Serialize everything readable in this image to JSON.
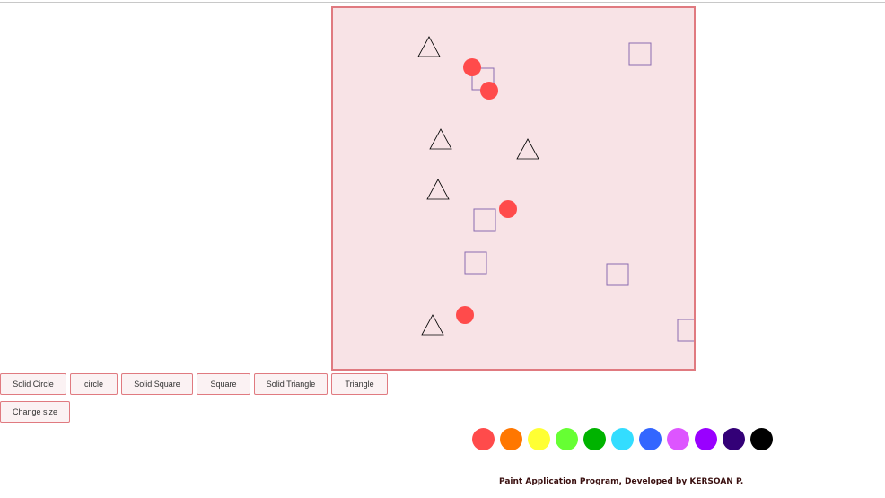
{
  "toolbar": {
    "solid_circle": "Solid Circle",
    "circle": "circle",
    "solid_square": "Solid Square",
    "square": "Square",
    "solid_triangle": "Solid Triangle",
    "triangle": "Triangle",
    "change_size": "Change size"
  },
  "canvas": {
    "background": "#f8e3e6",
    "border": "#e07a80",
    "shape_colors": {
      "solid_circle": "#ff4b4b",
      "square_stroke": "#8a6bb0",
      "triangle_stroke": "#000000"
    }
  },
  "palette": [
    {
      "name": "red",
      "color": "#ff4b4b"
    },
    {
      "name": "orange",
      "color": "#ff7700"
    },
    {
      "name": "yellow",
      "color": "#ffff33"
    },
    {
      "name": "light-green",
      "color": "#66ff33"
    },
    {
      "name": "green",
      "color": "#00b300"
    },
    {
      "name": "cyan",
      "color": "#33ddff"
    },
    {
      "name": "blue",
      "color": "#3366ff"
    },
    {
      "name": "pink-violet",
      "color": "#dd55ff"
    },
    {
      "name": "purple",
      "color": "#9900ff"
    },
    {
      "name": "indigo",
      "color": "#330077"
    },
    {
      "name": "black",
      "color": "#000000"
    }
  ],
  "footer": {
    "text": "Paint Application Program, Developed by KERSOAN P."
  }
}
